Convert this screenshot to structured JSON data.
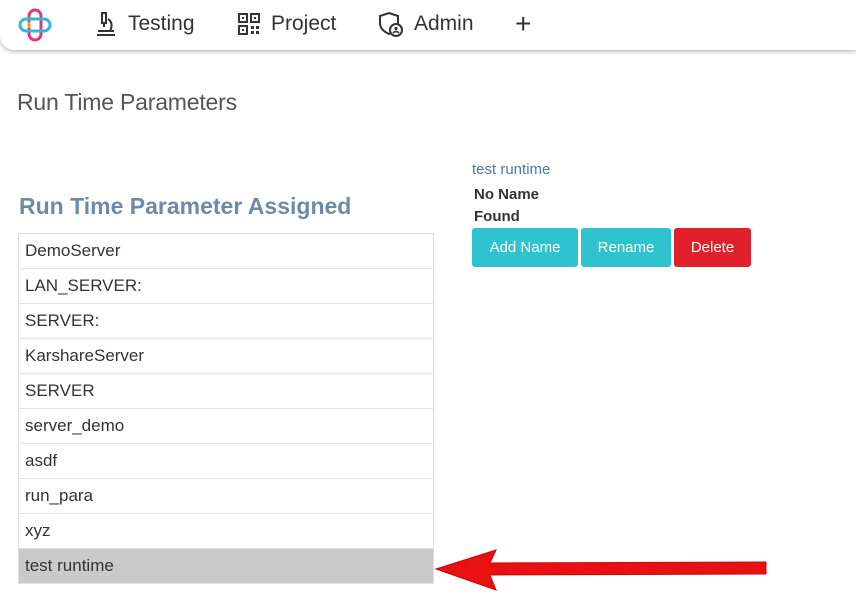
{
  "nav": {
    "logo": "app-logo",
    "items": [
      {
        "label": "Testing",
        "icon": "microscope-icon"
      },
      {
        "label": "Project",
        "icon": "qr-code-icon"
      },
      {
        "label": "Admin",
        "icon": "shield-user-icon"
      }
    ],
    "add_label": "+"
  },
  "page": {
    "title": "Run Time Parameters"
  },
  "assigned": {
    "title": "Run Time Parameter Assigned",
    "items": [
      "DemoServer",
      "LAN_SERVER:",
      "SERVER:",
      "KarshareServer",
      "SERVER",
      "server_demo",
      "asdf",
      "run_para",
      "xyz",
      "test runtime"
    ],
    "selected_index": 9
  },
  "detail": {
    "name": "test runtime",
    "message_line1": "No Name",
    "message_line2": "Found",
    "buttons": {
      "add": "Add Name",
      "rename": "Rename",
      "delete": "Delete"
    }
  },
  "colors": {
    "accent": "#2fc3cf",
    "danger": "#e0202a",
    "section_title": "#6d8aa8",
    "selected_row": "#cacaca",
    "annotation_arrow": "#e81010"
  }
}
